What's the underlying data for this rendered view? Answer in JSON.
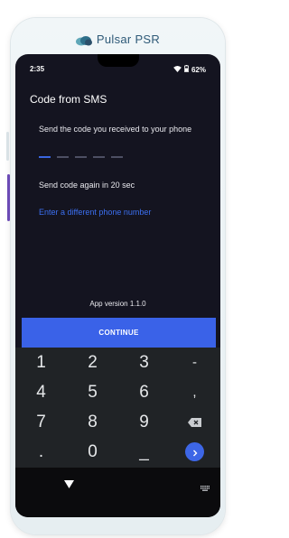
{
  "brand": {
    "name": "Pulsar PSR"
  },
  "status_bar": {
    "time": "2:35",
    "battery": "62%",
    "icons": [
      "wifi-icon",
      "battery-icon"
    ]
  },
  "screen": {
    "title": "Code from SMS",
    "instruction": "Send the code you received to your phone",
    "code_length": 5,
    "resend_text": "Send code again in 20 sec",
    "different_number_link": "Enter a different phone number",
    "app_version": "App version 1.1.0",
    "continue_button": "CONTINUE"
  },
  "keypad": {
    "rows": [
      [
        "1",
        "2",
        "3",
        "-"
      ],
      [
        "4",
        "5",
        "6",
        ","
      ],
      [
        "7",
        "8",
        "9",
        "backspace-icon"
      ],
      [
        ".",
        "0",
        "_",
        "enter-icon"
      ]
    ]
  },
  "colors": {
    "accent": "#3a62e8",
    "link": "#3b6ff0",
    "screen_bg": "#141420",
    "keypad_bg": "#202326"
  }
}
